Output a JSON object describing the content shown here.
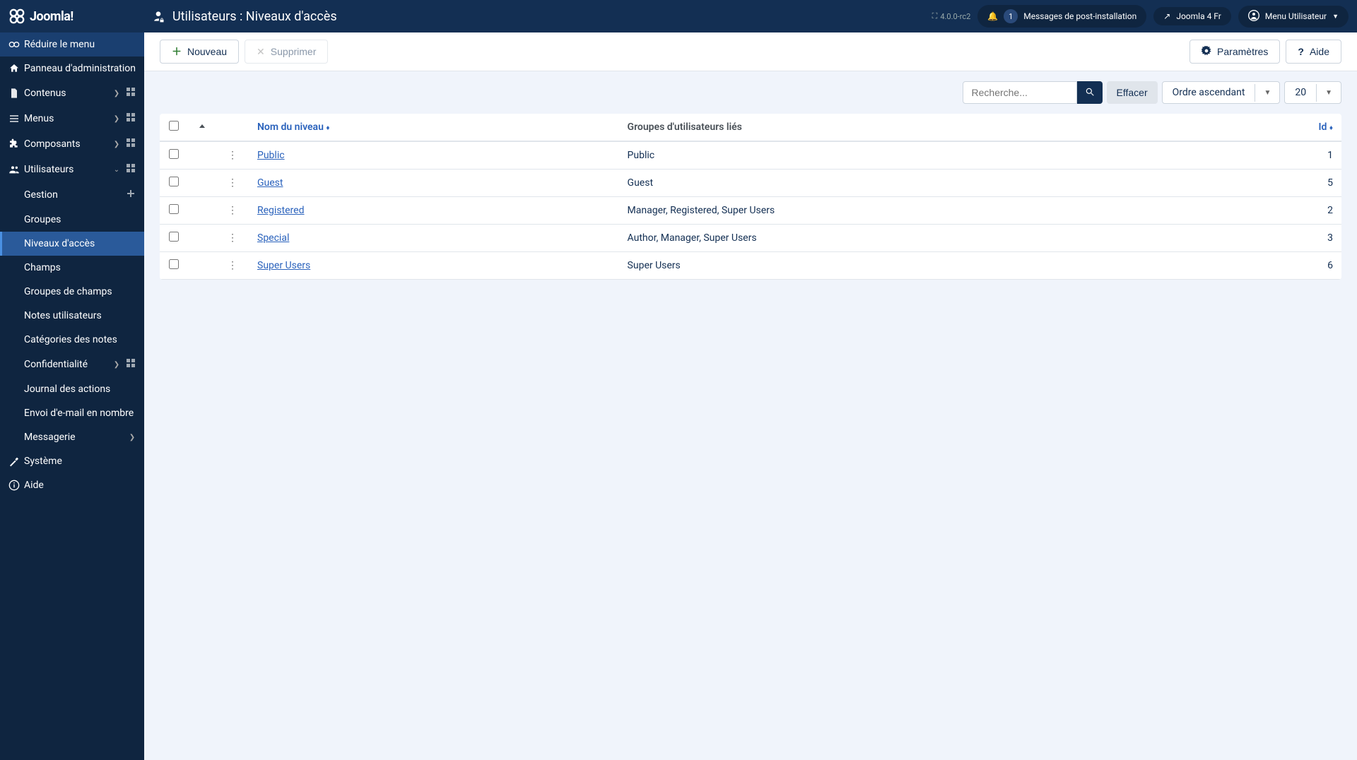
{
  "header": {
    "logo_text": "Joomla!",
    "page_title": "Utilisateurs : Niveaux d'accès",
    "version": "4.0.0-rc2",
    "notifications_count": "1",
    "notifications_label": "Messages de post-installation",
    "site_name": "Joomla 4 Fr",
    "user_menu": "Menu Utilisateur"
  },
  "sidebar": {
    "collapse": "Réduire le menu",
    "items": [
      {
        "label": "Panneau d'administration",
        "icon": "home"
      },
      {
        "label": "Contenus",
        "icon": "file",
        "expandable": true,
        "dashboard": true
      },
      {
        "label": "Menus",
        "icon": "bars",
        "expandable": true,
        "dashboard": true
      },
      {
        "label": "Composants",
        "icon": "puzzle",
        "expandable": true,
        "dashboard": true
      },
      {
        "label": "Utilisateurs",
        "icon": "users",
        "expandable": true,
        "dashboard": true,
        "expanded": true
      }
    ],
    "users_sub": [
      {
        "label": "Gestion",
        "plus": true
      },
      {
        "label": "Groupes"
      },
      {
        "label": "Niveaux d'accès",
        "active": true
      },
      {
        "label": "Champs"
      },
      {
        "label": "Groupes de champs"
      },
      {
        "label": "Notes utilisateurs"
      },
      {
        "label": "Catégories des notes"
      },
      {
        "label": "Confidentialité",
        "expandable": true,
        "dashboard": true
      },
      {
        "label": "Journal des actions"
      },
      {
        "label": "Envoi d'e-mail en nombre"
      },
      {
        "label": "Messagerie",
        "expandable": true
      }
    ],
    "bottom": [
      {
        "label": "Système",
        "icon": "wrench"
      },
      {
        "label": "Aide",
        "icon": "info"
      }
    ]
  },
  "toolbar": {
    "new": "Nouveau",
    "delete": "Supprimer",
    "options": "Paramètres",
    "help": "Aide"
  },
  "filters": {
    "search_placeholder": "Recherche...",
    "clear": "Effacer",
    "order": "Ordre ascendant",
    "limit": "20"
  },
  "table": {
    "headers": {
      "name": "Nom du niveau",
      "groups": "Groupes d'utilisateurs liés",
      "id": "Id"
    },
    "rows": [
      {
        "name": "Public",
        "groups": "Public",
        "id": "1"
      },
      {
        "name": "Guest",
        "groups": "Guest",
        "id": "5"
      },
      {
        "name": "Registered",
        "groups": "Manager, Registered, Super Users",
        "id": "2"
      },
      {
        "name": "Special",
        "groups": "Author, Manager, Super Users",
        "id": "3"
      },
      {
        "name": "Super Users",
        "groups": "Super Users",
        "id": "6"
      }
    ]
  }
}
